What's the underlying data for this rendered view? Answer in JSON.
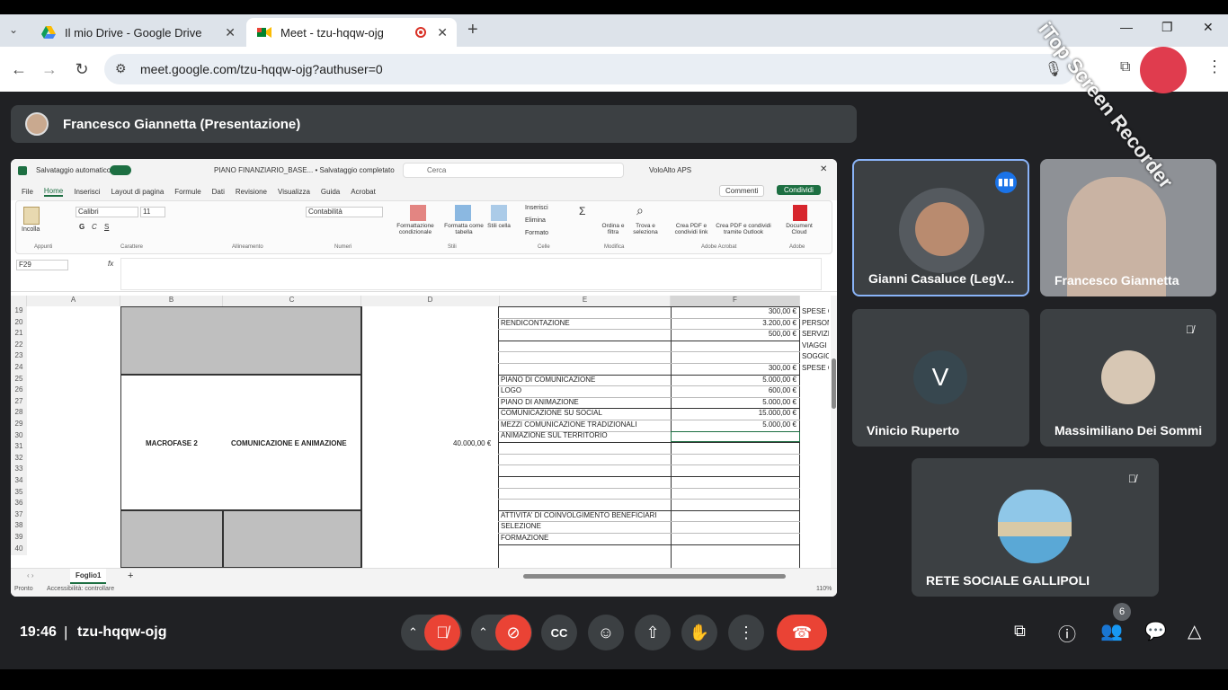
{
  "tabs": [
    {
      "title": "Il mio Drive - Google Drive",
      "icon": "drive-icon"
    },
    {
      "title": "Meet - tzu-hqqw-ojg",
      "icon": "meet-icon"
    }
  ],
  "address": {
    "url": "meet.google.com/tzu-hqqw-ojg?authuser=0"
  },
  "watermark": "iTop Screen Recorder",
  "presentation": {
    "title": "Francesco Giannetta (Presentazione)"
  },
  "excel": {
    "autosave_label": "Salvataggio automatico",
    "doc_title": "PIANO FINANZIARIO_BASE... • Salvataggio completato",
    "search_placeholder": "Cerca",
    "account": "VoloAlto APS",
    "menu": [
      "File",
      "Home",
      "Inserisci",
      "Layout di pagina",
      "Formule",
      "Dati",
      "Revisione",
      "Visualizza",
      "Guida",
      "Acrobat"
    ],
    "comments_label": "Commenti",
    "share_label": "Condividi",
    "name_box": "F29",
    "font_name": "Calibri",
    "font_size": "11",
    "number_format": "Contabilità",
    "ribbon_groups": [
      "Appunti",
      "Carattere",
      "Allineamento",
      "Numeri",
      "Stili",
      "Celle",
      "Modifica",
      "Adobe Acrobat",
      "Adobe"
    ],
    "ribbon_buttons": [
      "Incolla",
      "Formattazione condizionale",
      "Formatta come tabella",
      "Stili cella",
      "Inserisci",
      "Elimina",
      "Formato",
      "Ordina e filtra",
      "Trova e seleziona",
      "Crea PDF e condividi link",
      "Crea PDF e condividi tramite Outlook",
      "Document Cloud"
    ],
    "columns": [
      "A",
      "B",
      "C",
      "D",
      "E",
      "F"
    ],
    "rows": [
      "19",
      "20",
      "21",
      "22",
      "23",
      "24",
      "25",
      "26",
      "27",
      "28",
      "29",
      "30",
      "31",
      "32",
      "33",
      "34",
      "35",
      "36",
      "37",
      "38",
      "39",
      "40"
    ],
    "cells": {
      "macrofase": "MACROFASE 2",
      "fase": "COMUNICAZIONE E ANIMAZIONE",
      "importo": "40.000,00 €",
      "e20": "RENDICONTAZIONE",
      "e24": "PIANO DI COMUNICAZIONE",
      "e25": "LOGO",
      "e26": "PIANO DI ANIMAZIONE",
      "e27": "COMUNICAZIONE SU SOCIAL",
      "e28": "MEZZI COMUNICAZIONE TRADIZIONALI",
      "e29": "ANIMAZIONE SUL TERRITORIO",
      "e36": "ATTIVITA' DI COINVOLGIMENTO BENEFICIARI",
      "e37": "SELEZIONE",
      "e38": "FORMAZIONE",
      "f19": "300,00 €",
      "f20": "3.200,00 €",
      "f21": "500,00 €",
      "f23": "300,00 €",
      "f24": "5.000,00 €",
      "f25": "600,00 €",
      "f26": "5.000,00 €",
      "f27": "15.000,00 €",
      "f28": "5.000,00 €",
      "g19": "SPESE C",
      "g20": "PERSON",
      "g21": "SERVIZI",
      "g22a": "VIAGGI",
      "g22b": "SOGGIO",
      "g23": "SPESE C"
    },
    "sheet_tab": "Foglio1",
    "status_left": "Pronto",
    "status_access": "Accessibilità: controllare",
    "zoom": "110%"
  },
  "participants": [
    {
      "name": "Gianni Casaluce (LegV...",
      "speaking": true
    },
    {
      "name": "Francesco Giannetta",
      "muted": false
    },
    {
      "name": "Vinicio Ruperto",
      "initial": "V",
      "muted": false
    },
    {
      "name": "Massimiliano Dei Sommi",
      "muted": true
    },
    {
      "name": "RETE SOCIALE GALLIPOLI",
      "muted": true
    }
  ],
  "meeting": {
    "time": "19:46",
    "separator": "|",
    "code": "tzu-hqqw-ojg",
    "participant_count": "6"
  },
  "colors": {
    "accent": "#8ab4f8",
    "red": "#ea4335",
    "bg": "#202124",
    "tile": "#3c4043"
  }
}
